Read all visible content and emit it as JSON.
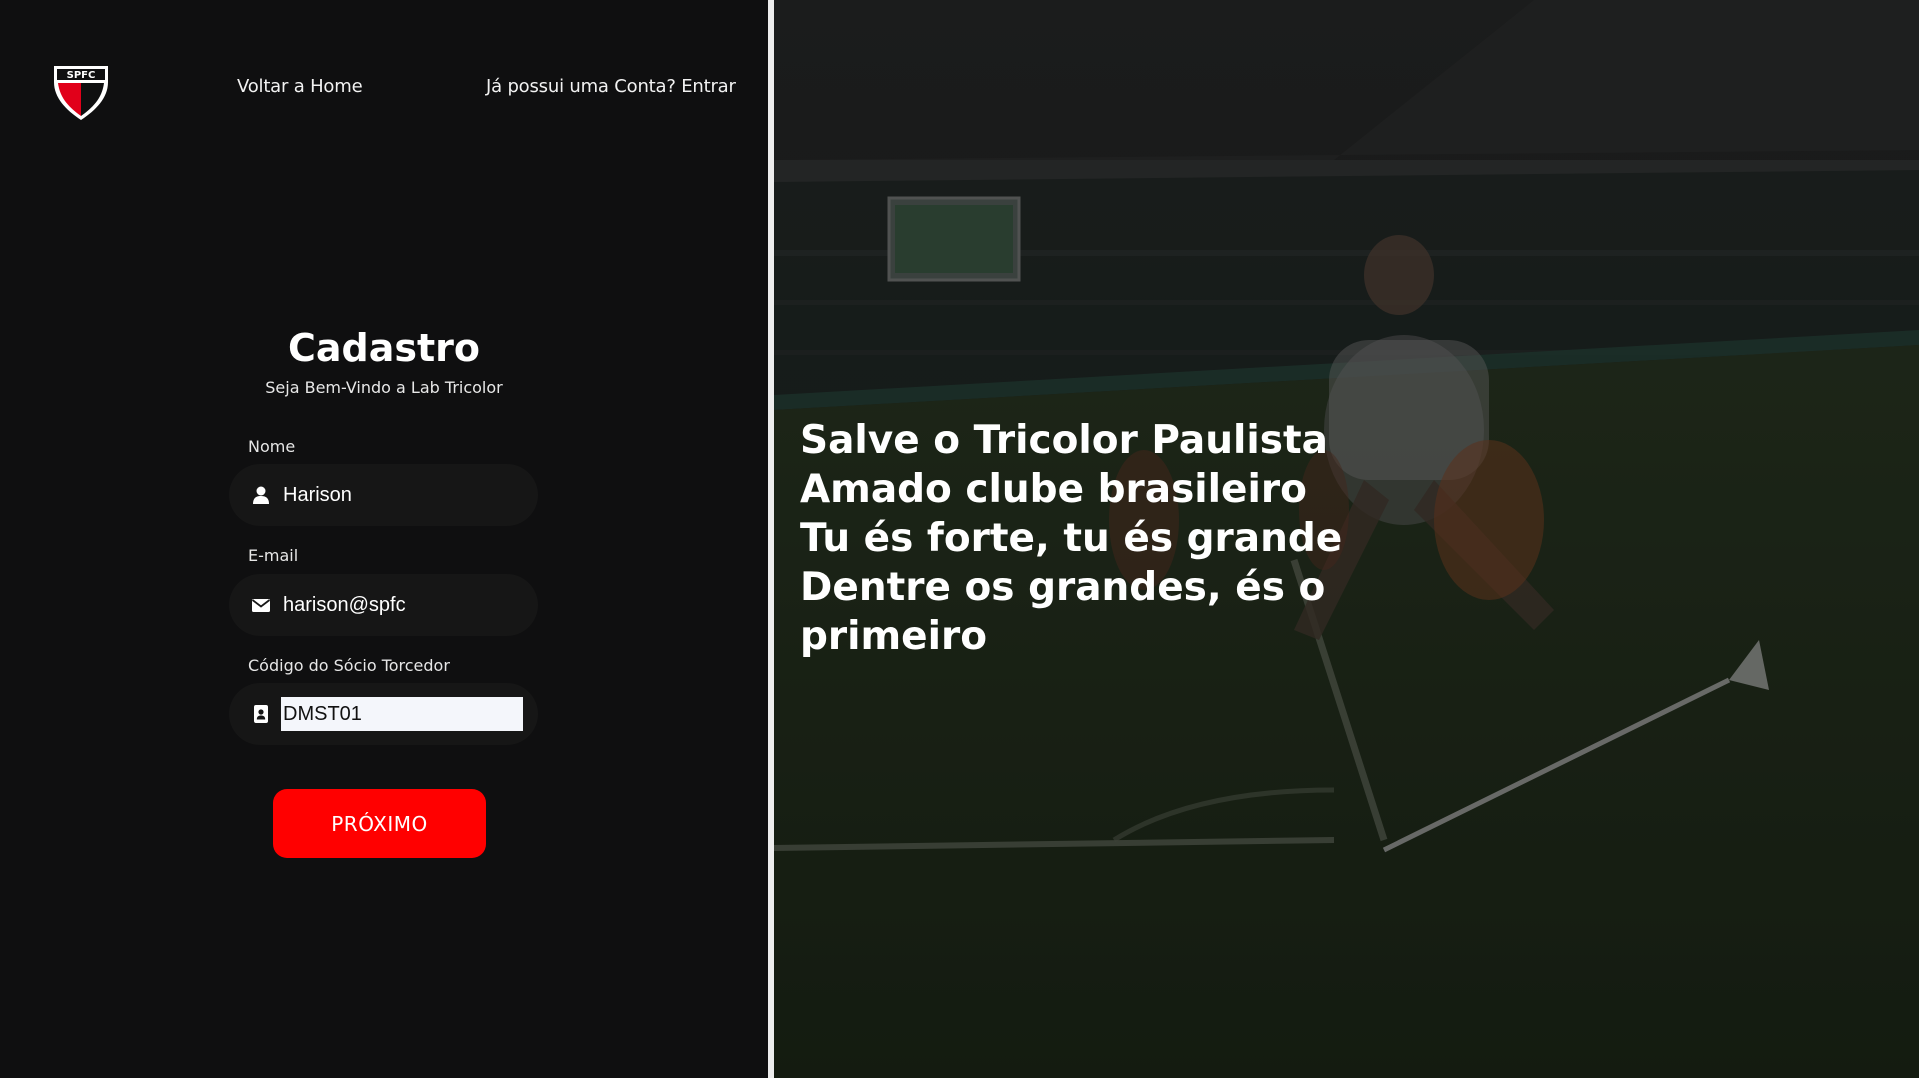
{
  "header": {
    "logo_text": "SPFC",
    "home_link": "Voltar a Home",
    "login_link": "Já possui uma Conta? Entrar"
  },
  "form": {
    "title": "Cadastro",
    "subtitle": "Seja Bem-Vindo a Lab Tricolor",
    "fields": [
      {
        "label": "Nome",
        "value": "Harison",
        "icon": "user-icon"
      },
      {
        "label": "E-mail",
        "value": "harison@spfc",
        "icon": "envelope-icon"
      },
      {
        "label": "Código do Sócio Torcedor",
        "value": "DMST01",
        "icon": "id-badge-icon"
      }
    ],
    "submit_label": "PRÓXIMO"
  },
  "hero": {
    "anthem_lines": [
      "Salve o Tricolor Paulista",
      "Amado clube brasileiro",
      "Tu és forte, tu és grande",
      "Dentre os grandes, és o",
      "primeiro"
    ]
  },
  "colors": {
    "panel_bg": "#0f0f10",
    "field_bg": "#161616",
    "accent_red": "#ff0000",
    "divider": "#ededed"
  }
}
